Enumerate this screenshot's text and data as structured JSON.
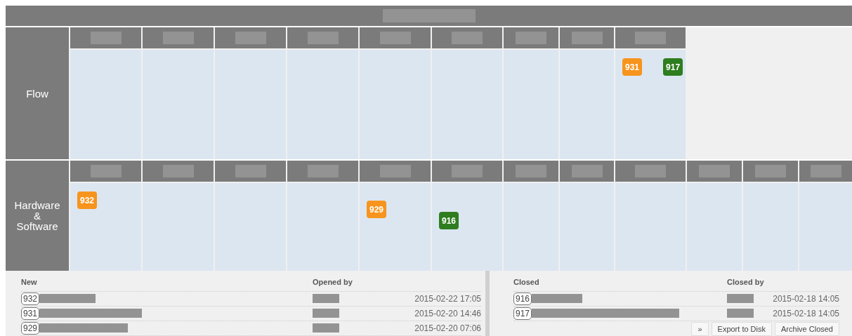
{
  "lanes": [
    {
      "name": "Flow",
      "columns": [
        {},
        {},
        {},
        {},
        {},
        {},
        {},
        {},
        {
          "cards": [
            {
              "number": "931",
              "color": "#f7941d"
            },
            {
              "number": "917",
              "color": "#2e7d1f"
            }
          ]
        }
      ]
    },
    {
      "name": "Hardware\n&\nSoftware",
      "columns": [
        {
          "cards": [
            {
              "number": "932",
              "color": "#f7941d"
            }
          ]
        },
        {},
        {},
        {},
        {
          "cards": [
            {
              "number": "929",
              "color": "#f7941d"
            }
          ]
        },
        {
          "cards": [
            {
              "number": "916",
              "color": "#2e7d1f"
            }
          ]
        },
        {},
        {},
        {},
        {},
        {},
        {}
      ]
    }
  ],
  "new_list": {
    "title": "New",
    "by_heading": "Opened by",
    "rows": [
      {
        "number": "932",
        "date": "2015-02-22 17:05"
      },
      {
        "number": "931",
        "date": "2015-02-20 14:46"
      },
      {
        "number": "929",
        "date": "2015-02-20 07:06"
      }
    ]
  },
  "closed_list": {
    "title": "Closed",
    "by_heading": "Closed by",
    "rows": [
      {
        "number": "916",
        "date": "2015-02-18 14:05"
      },
      {
        "number": "917",
        "date": "2015-02-18 14:05"
      }
    ]
  },
  "buttons": [
    "»",
    "Export to Disk",
    "Archive Closed"
  ]
}
